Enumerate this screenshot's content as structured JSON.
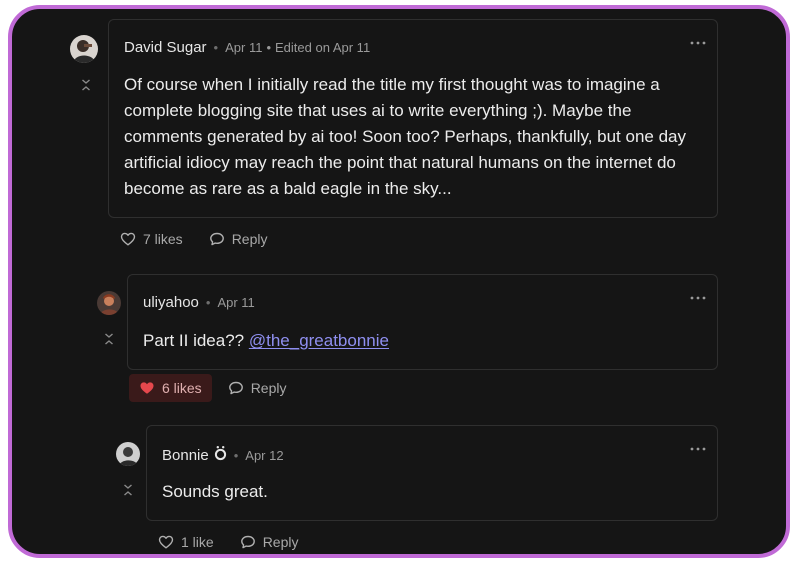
{
  "comments": [
    {
      "author": "David Sugar",
      "date": "Apr 11",
      "edited": "Edited on Apr 11",
      "body_lines": [
        "Of course when I initially read the title my first thought was to imagine a",
        "complete blogging site that uses ai to write everything ;). Maybe the",
        "comments generated by ai too! Soon too? Perhaps, thankfully, but one day",
        "artificial idiocy may reach the point that natural humans on the internet do",
        "become as rare as a bald eagle in the sky..."
      ],
      "likes_label": "7 likes",
      "liked": false,
      "reply_label": "Reply"
    },
    {
      "author": "uliyahoo",
      "date": "Apr 11",
      "body_prefix": "Part II idea?? ",
      "mention": "@the_greatbonnie",
      "likes_label": "6 likes",
      "liked": true,
      "reply_label": "Reply"
    },
    {
      "author": "Bonnie",
      "date": "Apr 12",
      "body": "Sounds great.",
      "likes_label": "1 like",
      "liked": false,
      "reply_label": "Reply"
    }
  ],
  "colors": {
    "frame_border": "#c06ad6",
    "background": "#151515",
    "mention": "#8f8ff0",
    "liked_heart": "#e5484d",
    "liked_bg": "#3a1a1a"
  },
  "icons": {
    "like": "heart-outline-icon",
    "liked": "heart-filled-icon",
    "reply": "speech-bubble-icon",
    "more": "ellipsis-icon",
    "collapse": "collapse-chevrons-icon",
    "badge": "founder-badge-icon"
  }
}
